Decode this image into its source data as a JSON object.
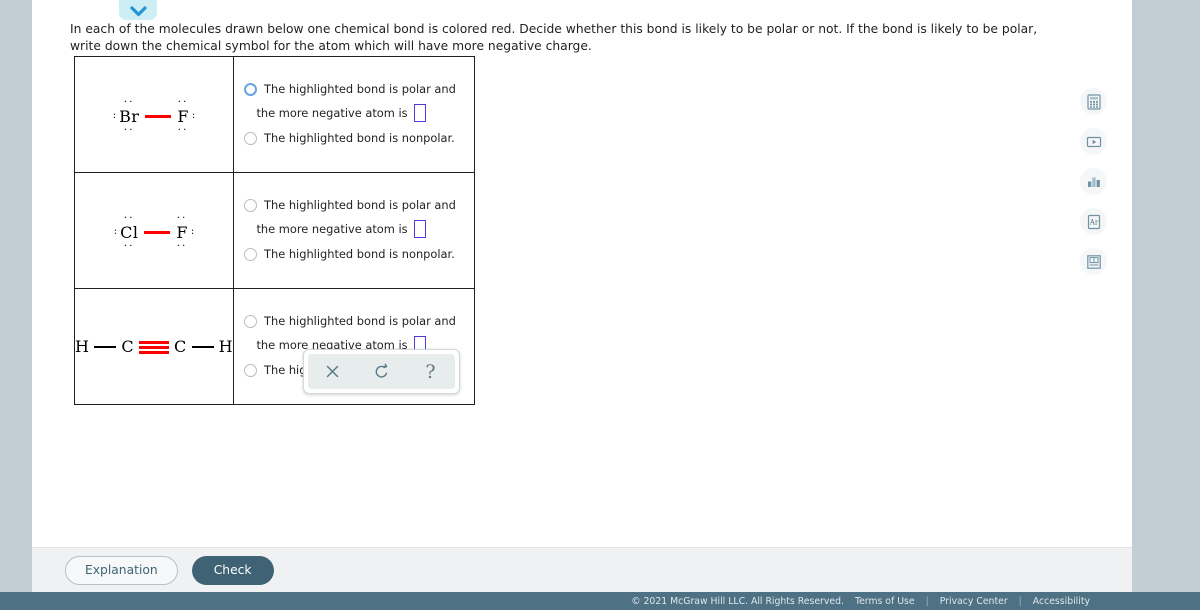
{
  "collapse_tab": {
    "icon": "chevron-down-icon"
  },
  "instructions": "In each of the molecules drawn below one chemical bond is colored red. Decide whether this bond is likely to be polar or not. If the bond is likely to be polar, write down the chemical symbol for the atom which will have more negative charge.",
  "colors": {
    "bond_highlight": "#ff0000",
    "answer_box_border": "#4a3ce0",
    "radio_focus": "#6ba3e0",
    "page_background": "#c2ced4",
    "footer_background": "#4e7183",
    "check_button": "#3f6374"
  },
  "option_labels": {
    "polar": "The highlighted bond is polar and",
    "polar_sub": "the more negative atom is",
    "nonpolar": "The highlighted bond is nonpolar."
  },
  "rows": [
    {
      "molecule": {
        "name": "bromine-monofluoride",
        "left_atom": "Br",
        "right_atom": "F",
        "bond_type": "single",
        "bond_color": "#ff0000",
        "left_lone_pairs": {
          "top": "··",
          "bottom": "··",
          "left": ":"
        },
        "right_lone_pairs": {
          "top": "··",
          "bottom": "··",
          "right": ":"
        }
      },
      "answer_value": "",
      "polar_radio_state": "focused",
      "nonpolar_radio_state": "unselected"
    },
    {
      "molecule": {
        "name": "chlorine-monofluoride",
        "left_atom": "Cl",
        "right_atom": "F",
        "bond_type": "single",
        "bond_color": "#ff0000",
        "left_lone_pairs": {
          "top": "··",
          "bottom": "··",
          "left": ":"
        },
        "right_lone_pairs": {
          "top": "··",
          "bottom": "··",
          "right": ":"
        }
      },
      "answer_value": "",
      "polar_radio_state": "unselected",
      "nonpolar_radio_state": "unselected"
    },
    {
      "molecule": {
        "name": "acetylene",
        "atoms": [
          "H",
          "C",
          "C",
          "H"
        ],
        "bond_type": "triple-center",
        "bond_color": "#ff0000"
      },
      "answer_value": "",
      "polar_radio_state": "unselected",
      "nonpolar_radio_state": "unselected"
    }
  ],
  "toolbar": {
    "clear_label": "×",
    "undo_label": "↺",
    "help_label": "?"
  },
  "rail": [
    {
      "name": "calculator-icon"
    },
    {
      "name": "video-player-icon"
    },
    {
      "name": "bar-chart-icon"
    },
    {
      "name": "periodic-element-icon",
      "label": "Ar"
    },
    {
      "name": "reference-book-icon"
    }
  ],
  "actions": {
    "explanation": "Explanation",
    "check": "Check"
  },
  "footer": {
    "copyright": "© 2021 McGraw Hill LLC. All Rights Reserved.",
    "links": [
      "Terms of Use",
      "Privacy Center",
      "Accessibility"
    ],
    "separator": "|"
  }
}
